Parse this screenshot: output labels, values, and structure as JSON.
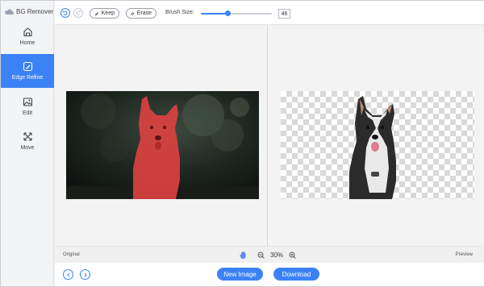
{
  "app": {
    "title": "BG Remover"
  },
  "sidebar": {
    "items": [
      {
        "label": "Home",
        "icon": "home-icon",
        "active": false
      },
      {
        "label": "Edge Refine",
        "icon": "edge-refine-icon",
        "active": true
      },
      {
        "label": "Edit",
        "icon": "image-edit-icon",
        "active": false
      },
      {
        "label": "Move",
        "icon": "move-icon",
        "active": false
      }
    ]
  },
  "toolbar": {
    "keep_label": "Keep",
    "erase_label": "Erase",
    "brush_label": "Brush Size:",
    "brush_size": "46",
    "brush_fraction": 0.38
  },
  "status": {
    "original_label": "Original",
    "preview_label": "Preview",
    "zoom": "30%"
  },
  "actions": {
    "new_image": "New Image",
    "download": "Download"
  },
  "colors": {
    "accent": "#3b82f6",
    "mask": "#e53b3b"
  }
}
